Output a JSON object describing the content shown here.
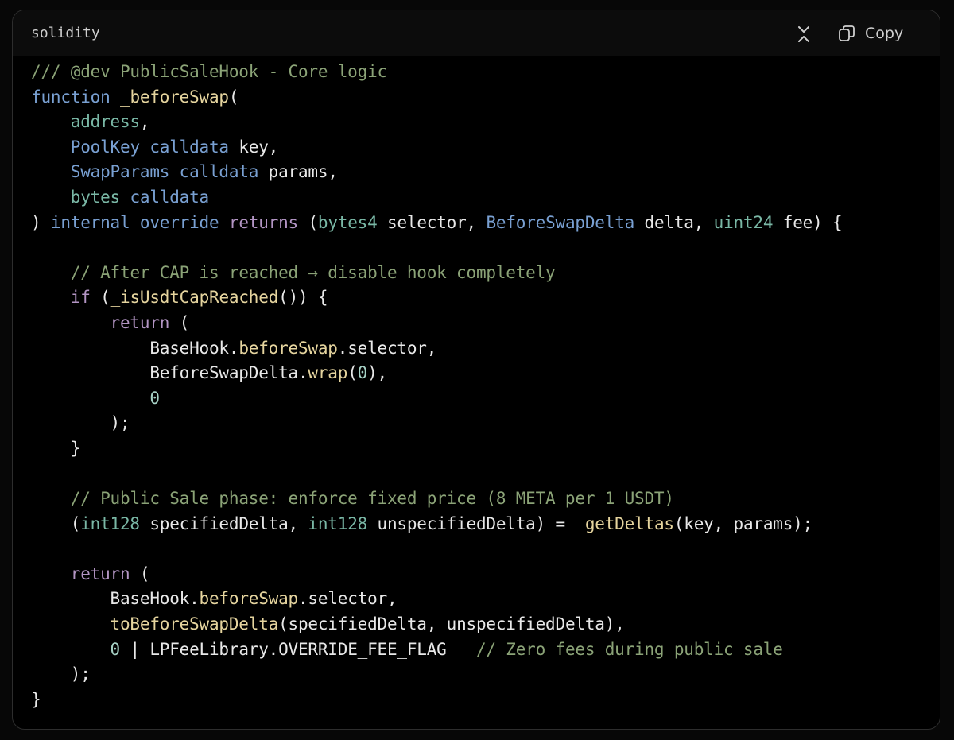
{
  "header": {
    "language": "solidity",
    "copy_label": "Copy",
    "collapse_icon": "collapse-icon",
    "copy_icon": "copy-icon"
  },
  "colors": {
    "comment": "#8ba377",
    "keyword": "#b395c4",
    "type": "#7ab8a6",
    "user_type": "#79a0d2",
    "function": "#e5d49e",
    "number": "#a6d1c5",
    "plain": "#e8e8e8"
  },
  "code": {
    "lines": [
      [
        [
          "cm",
          "/// @dev PublicSaleHook - Core logic"
        ]
      ],
      [
        [
          "ut",
          "function "
        ],
        [
          "fn",
          "_beforeSwap"
        ],
        [
          "pl",
          "("
        ]
      ],
      [
        [
          "pl",
          "    "
        ],
        [
          "ty",
          "address"
        ],
        [
          "pl",
          ","
        ]
      ],
      [
        [
          "pl",
          "    "
        ],
        [
          "ut",
          "PoolKey "
        ],
        [
          "ut",
          "calldata "
        ],
        [
          "pl",
          "key,"
        ]
      ],
      [
        [
          "pl",
          "    "
        ],
        [
          "ut",
          "SwapParams "
        ],
        [
          "ut",
          "calldata "
        ],
        [
          "pl",
          "params,"
        ]
      ],
      [
        [
          "pl",
          "    "
        ],
        [
          "ty",
          "bytes "
        ],
        [
          "ut",
          "calldata"
        ]
      ],
      [
        [
          "pl",
          ") "
        ],
        [
          "ut",
          "internal "
        ],
        [
          "ut",
          "override "
        ],
        [
          "kw",
          "returns "
        ],
        [
          "pl",
          "("
        ],
        [
          "ty",
          "bytes4 "
        ],
        [
          "pl",
          "selector, "
        ],
        [
          "ut",
          "BeforeSwapDelta "
        ],
        [
          "pl",
          "delta, "
        ],
        [
          "ty",
          "uint24 "
        ],
        [
          "pl",
          "fee) {"
        ]
      ],
      [
        [
          "pl",
          ""
        ]
      ],
      [
        [
          "pl",
          "    "
        ],
        [
          "cm",
          "// After CAP is reached → disable hook completely"
        ]
      ],
      [
        [
          "pl",
          "    "
        ],
        [
          "kw",
          "if "
        ],
        [
          "pl",
          "("
        ],
        [
          "fn",
          "_isUsdtCapReached"
        ],
        [
          "pl",
          "()) {"
        ]
      ],
      [
        [
          "pl",
          "        "
        ],
        [
          "kw",
          "return "
        ],
        [
          "pl",
          "("
        ]
      ],
      [
        [
          "pl",
          "            BaseHook."
        ],
        [
          "fn",
          "beforeSwap"
        ],
        [
          "pl",
          ".selector,"
        ]
      ],
      [
        [
          "pl",
          "            BeforeSwapDelta."
        ],
        [
          "fn",
          "wrap"
        ],
        [
          "pl",
          "("
        ],
        [
          "nu",
          "0"
        ],
        [
          "pl",
          "),"
        ]
      ],
      [
        [
          "pl",
          "            "
        ],
        [
          "nu",
          "0"
        ]
      ],
      [
        [
          "pl",
          "        );"
        ]
      ],
      [
        [
          "pl",
          "    }"
        ]
      ],
      [
        [
          "pl",
          ""
        ]
      ],
      [
        [
          "pl",
          "    "
        ],
        [
          "cm",
          "// Public Sale phase: enforce fixed price (8 META per 1 USDT)"
        ]
      ],
      [
        [
          "pl",
          "    ("
        ],
        [
          "ty",
          "int128 "
        ],
        [
          "pl",
          "specifiedDelta, "
        ],
        [
          "ty",
          "int128 "
        ],
        [
          "pl",
          "unspecifiedDelta) = "
        ],
        [
          "fn",
          "_getDeltas"
        ],
        [
          "pl",
          "(key, params);"
        ]
      ],
      [
        [
          "pl",
          ""
        ]
      ],
      [
        [
          "pl",
          "    "
        ],
        [
          "kw",
          "return "
        ],
        [
          "pl",
          "("
        ]
      ],
      [
        [
          "pl",
          "        BaseHook."
        ],
        [
          "fn",
          "beforeSwap"
        ],
        [
          "pl",
          ".selector,"
        ]
      ],
      [
        [
          "pl",
          "        "
        ],
        [
          "fn",
          "toBeforeSwapDelta"
        ],
        [
          "pl",
          "(specifiedDelta, unspecifiedDelta),"
        ]
      ],
      [
        [
          "pl",
          "        "
        ],
        [
          "nu",
          "0"
        ],
        [
          "pl",
          " | LPFeeLibrary.OVERRIDE_FEE_FLAG   "
        ],
        [
          "cm",
          "// Zero fees during public sale"
        ]
      ],
      [
        [
          "pl",
          "    );"
        ]
      ],
      [
        [
          "pl",
          "}"
        ]
      ]
    ]
  }
}
